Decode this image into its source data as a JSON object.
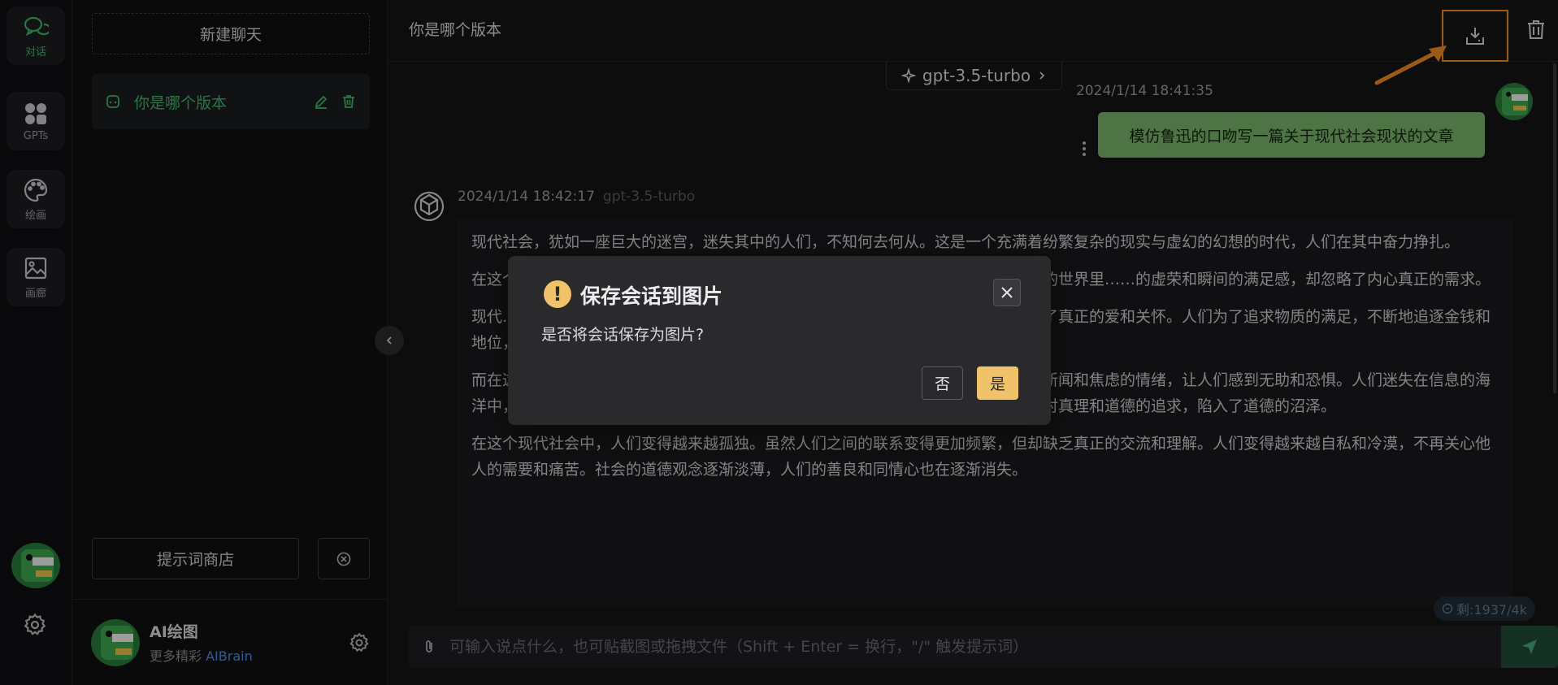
{
  "rail": {
    "items": [
      {
        "label": "对话",
        "icon": "chat-bubbles-icon",
        "active": true
      },
      {
        "label": "GPTs",
        "icon": "grid-apps-icon",
        "active": false
      },
      {
        "label": "绘画",
        "icon": "palette-icon",
        "active": false
      },
      {
        "label": "画廊",
        "icon": "image-gallery-icon",
        "active": false
      }
    ]
  },
  "sidebar": {
    "new_chat": "新建聊天",
    "sessions": [
      {
        "title": "你是哪个版本"
      }
    ],
    "prompt_shop": "提示词商店",
    "profile": {
      "name": "AI绘图",
      "sub_prefix": "更多精彩",
      "sub_brand": "AIBrain"
    }
  },
  "header": {
    "title": "你是哪个版本"
  },
  "chat": {
    "model_pill": "gpt-3.5-turbo",
    "user_message": {
      "time": "2024/1/14 18:41:35",
      "text": "模仿鲁迅的口吻写一篇关于现代社会现状的文章"
    },
    "bot_message": {
      "time": "2024/1/14 18:42:17",
      "model": "gpt-3.5-turbo",
      "paragraphs": [
        "现代社会，犹如一座巨大的迷宫，迷失其中的人们，不知何去何从。这是一个充满着纷繁复杂的现实与虚幻的幻想的时代，人们在其中奋力挣扎。",
        "在这个时代里……。社交媒体的兴起，让人们不再关注真实的生活，而是沉浸在虚拟的世界里……的虚荣和瞬间的满足感，却忽略了内心真正的需求。",
        "现代……波劳碌。工作成了生活的主旋律，时间变得如此宝贵，以至于人们……缺少了真正的爱和关怀。人们为了追求物质的满足，不断地追逐金钱和地位，却忽略了内心的平静和幸福。",
        "而在这个信息爆炸的时代，人们被各种各样的信息所包围。媒体的报道充斥着负面的新闻和焦虑的情绪，让人们感到无助和恐惧。人们迷失在信息的海洋中，不知道该相信谁，该听从谁的指引。价值观的多元化和碎片化，让人们失去了对真理和道德的追求，陷入了道德的沼泽。",
        "在这个现代社会中，人们变得越来越孤独。虽然人们之间的联系变得更加频繁，但却缺乏真正的交流和理解。人们变得越来越自私和冷漠，不再关心他人的需要和痛苦。社会的道德观念逐渐淡薄，人们的善良和同情心也在逐渐消失。"
      ]
    }
  },
  "input": {
    "placeholder": "可输入说点什么，也可贴截图或拖拽文件（Shift + Enter = 换行，\"/\" 触发提示词）"
  },
  "counter": "剩:1937/4k",
  "modal": {
    "title": "保存会话到图片",
    "text": "是否将会话保存为图片?",
    "no": "否",
    "yes": "是"
  },
  "colors": {
    "accent_green": "#3fb56a",
    "highlight_orange": "#f08a24",
    "confirm_yellow": "#f0c36a",
    "user_bubble": "#79b26b"
  }
}
